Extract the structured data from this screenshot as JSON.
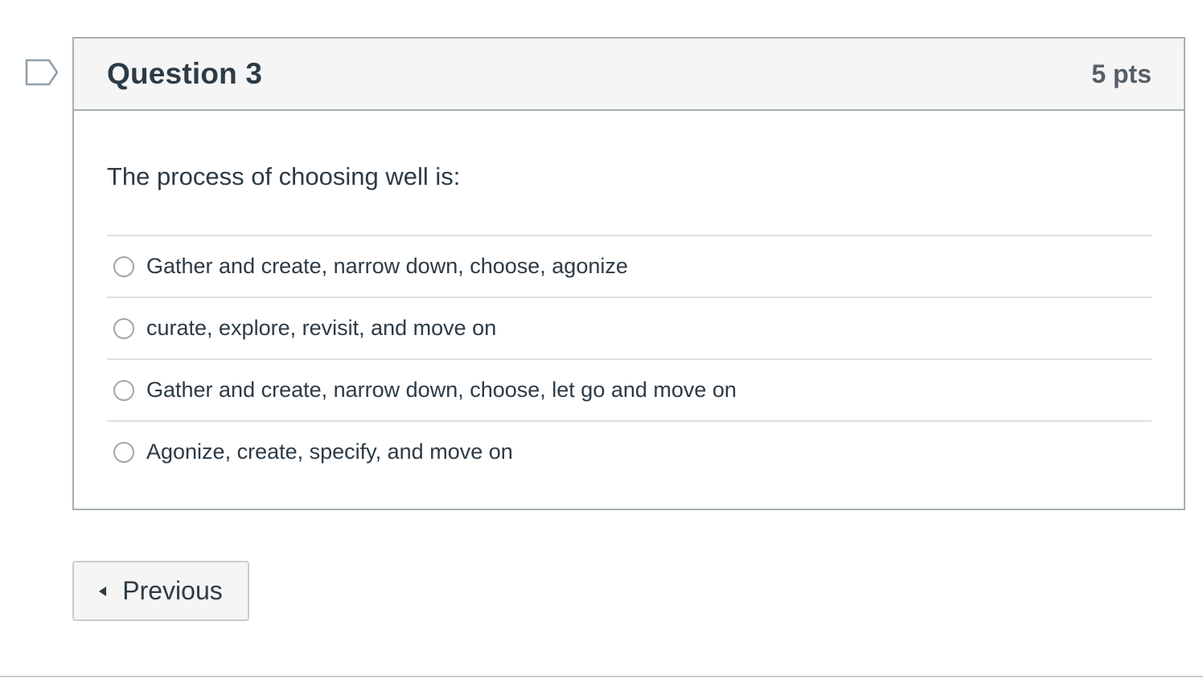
{
  "question": {
    "title": "Question 3",
    "points": "5 pts",
    "text": "The process of choosing well is:",
    "answers": [
      {
        "label": "Gather and create, narrow down, choose, agonize"
      },
      {
        "label": "curate, explore, revisit, and move on"
      },
      {
        "label": "Gather and create, narrow down, choose, let go and move on"
      },
      {
        "label": "Agonize, create, specify, and move on"
      }
    ]
  },
  "navigation": {
    "previous_label": "Previous"
  },
  "icons": {
    "flag": "flag-question-icon",
    "previous": "caret-left-icon"
  },
  "colors": {
    "text": "#2d3b45",
    "header_bg": "#f5f5f5",
    "border": "#a5afb5"
  }
}
